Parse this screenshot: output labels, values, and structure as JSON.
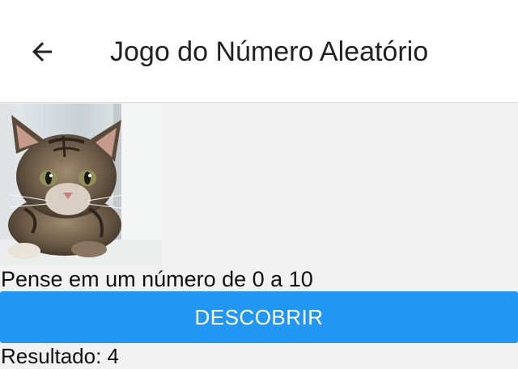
{
  "appbar": {
    "title": "Jogo do Número Aleatório",
    "back_icon": "arrow-left-icon"
  },
  "main": {
    "image": "cat-photo",
    "prompt": "Pense em um número de 0 a 10",
    "button_label": "DESCOBRIR",
    "result_text": "Resultado: 4"
  },
  "colors": {
    "primary": "#2196f3",
    "appbar_bg": "#ffffff",
    "body_bg": "#f1f1f1",
    "text": "#212121"
  }
}
